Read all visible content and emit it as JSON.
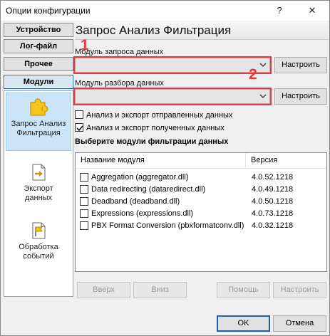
{
  "window": {
    "title": "Опции конфигурации",
    "help_glyph": "?",
    "close_glyph": "✕"
  },
  "sidebar": {
    "tabs": [
      {
        "label": "Устройство",
        "active": false
      },
      {
        "label": "Лог-файл",
        "active": false
      },
      {
        "label": "Прочее",
        "active": false
      },
      {
        "label": "Модули",
        "active": true
      }
    ],
    "items": [
      {
        "label_line1": "Запрос Анализ",
        "label_line2": "Фильтрация",
        "icon": "puzzle-icon",
        "selected": true
      },
      {
        "label_line1": "Экспорт",
        "label_line2": "данных",
        "icon": "export-doc-icon",
        "selected": false
      },
      {
        "label_line1": "Обработка",
        "label_line2": "событий",
        "icon": "event-flag-icon",
        "selected": false
      }
    ]
  },
  "main": {
    "header": "Запрос Анализ Фильтрация",
    "request_module_label": "Модуль запроса данных",
    "parse_module_label": "Модуль разбора данных",
    "configure_label": "Настроить",
    "marker_1": "1",
    "marker_2": "2",
    "export_sent_label": "Анализ и экспорт отправленных данных",
    "export_sent_checked": false,
    "export_received_label": "Анализ и экспорт полученных данных",
    "export_received_checked": true,
    "filter_section_title": "Выберите модули фильтрации данных",
    "table": {
      "columns": [
        "Название модуля",
        "Версия"
      ],
      "rows": [
        {
          "name": "Aggregation (aggregator.dll)",
          "version": "4.0.52.1218",
          "checked": false
        },
        {
          "name": "Data redirecting (dataredirect.dll)",
          "version": "4.0.49.1218",
          "checked": false
        },
        {
          "name": "Deadband (deadband.dll)",
          "version": "4.0.50.1218",
          "checked": false
        },
        {
          "name": "Expressions (expressions.dll)",
          "version": "4.0.73.1218",
          "checked": false
        },
        {
          "name": "PBX Format Conversion (pbxformatconv.dll)",
          "version": "4.0.32.1218",
          "checked": false
        }
      ]
    },
    "buttons": {
      "up": "Вверх",
      "down": "Вниз",
      "help": "Помощь",
      "configure": "Настроить"
    }
  },
  "footer": {
    "ok": "OK",
    "cancel": "Отмена"
  },
  "colors": {
    "accent_blue": "#1b5fb5",
    "highlight_red": "#e8383d"
  }
}
